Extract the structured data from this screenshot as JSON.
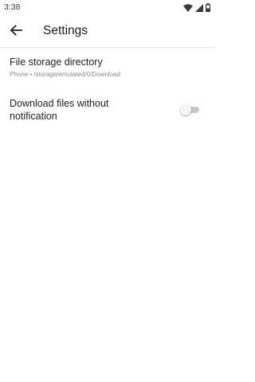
{
  "status_bar": {
    "time": "3:38",
    "icons": [
      "wifi-icon",
      "cell-signal-icon",
      "battery-icon"
    ]
  },
  "app_bar": {
    "back_icon": "arrow-left-icon",
    "title": "Settings"
  },
  "settings": {
    "storage": {
      "title": "File storage directory",
      "subtitle": "Phone • /storage/emulated/0/Download"
    },
    "notify": {
      "title": "Download files without notification",
      "enabled": false
    }
  },
  "colors": {
    "background": "#ffffff",
    "text_primary": "#222222",
    "text_secondary": "#8a8a8a",
    "toggle_track_off": "#c8c8c8"
  }
}
